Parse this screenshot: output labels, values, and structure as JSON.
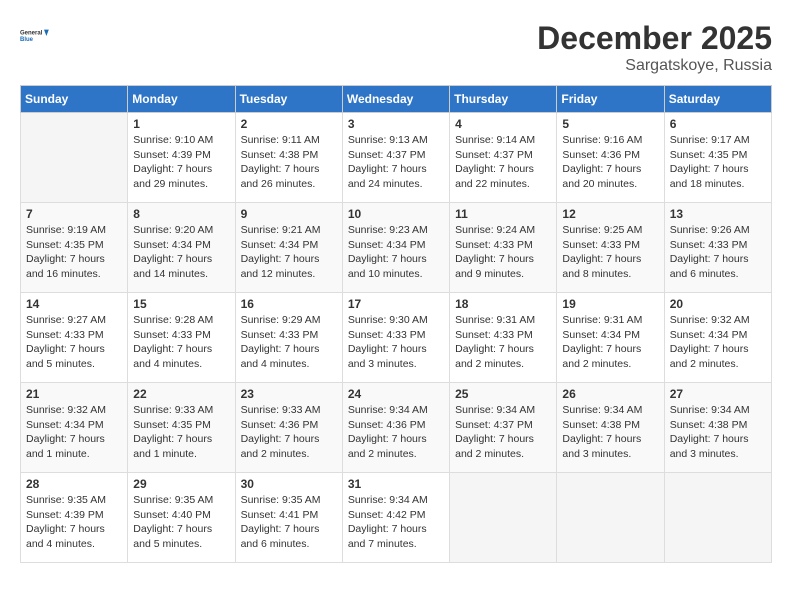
{
  "logo": {
    "line1": "General",
    "line2": "Blue"
  },
  "title": "December 2025",
  "location": "Sargatskoye, Russia",
  "days_of_week": [
    "Sunday",
    "Monday",
    "Tuesday",
    "Wednesday",
    "Thursday",
    "Friday",
    "Saturday"
  ],
  "weeks": [
    [
      {
        "day": "",
        "info": ""
      },
      {
        "day": "1",
        "info": "Sunrise: 9:10 AM\nSunset: 4:39 PM\nDaylight: 7 hours\nand 29 minutes."
      },
      {
        "day": "2",
        "info": "Sunrise: 9:11 AM\nSunset: 4:38 PM\nDaylight: 7 hours\nand 26 minutes."
      },
      {
        "day": "3",
        "info": "Sunrise: 9:13 AM\nSunset: 4:37 PM\nDaylight: 7 hours\nand 24 minutes."
      },
      {
        "day": "4",
        "info": "Sunrise: 9:14 AM\nSunset: 4:37 PM\nDaylight: 7 hours\nand 22 minutes."
      },
      {
        "day": "5",
        "info": "Sunrise: 9:16 AM\nSunset: 4:36 PM\nDaylight: 7 hours\nand 20 minutes."
      },
      {
        "day": "6",
        "info": "Sunrise: 9:17 AM\nSunset: 4:35 PM\nDaylight: 7 hours\nand 18 minutes."
      }
    ],
    [
      {
        "day": "7",
        "info": "Sunrise: 9:19 AM\nSunset: 4:35 PM\nDaylight: 7 hours\nand 16 minutes."
      },
      {
        "day": "8",
        "info": "Sunrise: 9:20 AM\nSunset: 4:34 PM\nDaylight: 7 hours\nand 14 minutes."
      },
      {
        "day": "9",
        "info": "Sunrise: 9:21 AM\nSunset: 4:34 PM\nDaylight: 7 hours\nand 12 minutes."
      },
      {
        "day": "10",
        "info": "Sunrise: 9:23 AM\nSunset: 4:34 PM\nDaylight: 7 hours\nand 10 minutes."
      },
      {
        "day": "11",
        "info": "Sunrise: 9:24 AM\nSunset: 4:33 PM\nDaylight: 7 hours\nand 9 minutes."
      },
      {
        "day": "12",
        "info": "Sunrise: 9:25 AM\nSunset: 4:33 PM\nDaylight: 7 hours\nand 8 minutes."
      },
      {
        "day": "13",
        "info": "Sunrise: 9:26 AM\nSunset: 4:33 PM\nDaylight: 7 hours\nand 6 minutes."
      }
    ],
    [
      {
        "day": "14",
        "info": "Sunrise: 9:27 AM\nSunset: 4:33 PM\nDaylight: 7 hours\nand 5 minutes."
      },
      {
        "day": "15",
        "info": "Sunrise: 9:28 AM\nSunset: 4:33 PM\nDaylight: 7 hours\nand 4 minutes."
      },
      {
        "day": "16",
        "info": "Sunrise: 9:29 AM\nSunset: 4:33 PM\nDaylight: 7 hours\nand 4 minutes."
      },
      {
        "day": "17",
        "info": "Sunrise: 9:30 AM\nSunset: 4:33 PM\nDaylight: 7 hours\nand 3 minutes."
      },
      {
        "day": "18",
        "info": "Sunrise: 9:31 AM\nSunset: 4:33 PM\nDaylight: 7 hours\nand 2 minutes."
      },
      {
        "day": "19",
        "info": "Sunrise: 9:31 AM\nSunset: 4:34 PM\nDaylight: 7 hours\nand 2 minutes."
      },
      {
        "day": "20",
        "info": "Sunrise: 9:32 AM\nSunset: 4:34 PM\nDaylight: 7 hours\nand 2 minutes."
      }
    ],
    [
      {
        "day": "21",
        "info": "Sunrise: 9:32 AM\nSunset: 4:34 PM\nDaylight: 7 hours\nand 1 minute."
      },
      {
        "day": "22",
        "info": "Sunrise: 9:33 AM\nSunset: 4:35 PM\nDaylight: 7 hours\nand 1 minute."
      },
      {
        "day": "23",
        "info": "Sunrise: 9:33 AM\nSunset: 4:36 PM\nDaylight: 7 hours\nand 2 minutes."
      },
      {
        "day": "24",
        "info": "Sunrise: 9:34 AM\nSunset: 4:36 PM\nDaylight: 7 hours\nand 2 minutes."
      },
      {
        "day": "25",
        "info": "Sunrise: 9:34 AM\nSunset: 4:37 PM\nDaylight: 7 hours\nand 2 minutes."
      },
      {
        "day": "26",
        "info": "Sunrise: 9:34 AM\nSunset: 4:38 PM\nDaylight: 7 hours\nand 3 minutes."
      },
      {
        "day": "27",
        "info": "Sunrise: 9:34 AM\nSunset: 4:38 PM\nDaylight: 7 hours\nand 3 minutes."
      }
    ],
    [
      {
        "day": "28",
        "info": "Sunrise: 9:35 AM\nSunset: 4:39 PM\nDaylight: 7 hours\nand 4 minutes."
      },
      {
        "day": "29",
        "info": "Sunrise: 9:35 AM\nSunset: 4:40 PM\nDaylight: 7 hours\nand 5 minutes."
      },
      {
        "day": "30",
        "info": "Sunrise: 9:35 AM\nSunset: 4:41 PM\nDaylight: 7 hours\nand 6 minutes."
      },
      {
        "day": "31",
        "info": "Sunrise: 9:34 AM\nSunset: 4:42 PM\nDaylight: 7 hours\nand 7 minutes."
      },
      {
        "day": "",
        "info": ""
      },
      {
        "day": "",
        "info": ""
      },
      {
        "day": "",
        "info": ""
      }
    ]
  ]
}
